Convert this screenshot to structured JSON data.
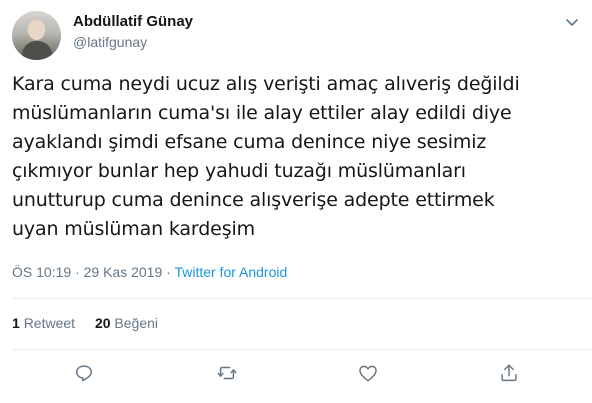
{
  "author": {
    "name": "Abdüllatif Günay",
    "handle": "@latifgunay"
  },
  "tweet": {
    "text": "Kara cuma neydi ucuz alış verişti amaç alıveriş değildi\nmüslümanların cuma'sı ile alay ettiler alay edildi diye\nayaklandı şimdi efsane cuma denince niye sesimiz\nçıkmıyor bunlar hep yahudi tuzağı müslümanları\nunutturup cuma denince alışverişe adepte ettirmek\nuyan müslüman kardeşim",
    "time": "ÖS 10:19",
    "separator1": " · ",
    "date": "29 Kas 2019",
    "separator2": " · ",
    "source": "Twitter for Android"
  },
  "stats": {
    "retweet_count": "1",
    "retweet_label": "Retweet",
    "like_count": "20",
    "like_label": "Beğeni"
  },
  "icons": {
    "reply": "reply-icon",
    "retweet": "retweet-icon",
    "like": "heart-icon",
    "share": "share-icon",
    "menu": "chevron-down-icon"
  },
  "colors": {
    "text": "#14171a",
    "secondary": "#657786",
    "link": "#1b95e0",
    "divider": "#e6ecf0"
  }
}
